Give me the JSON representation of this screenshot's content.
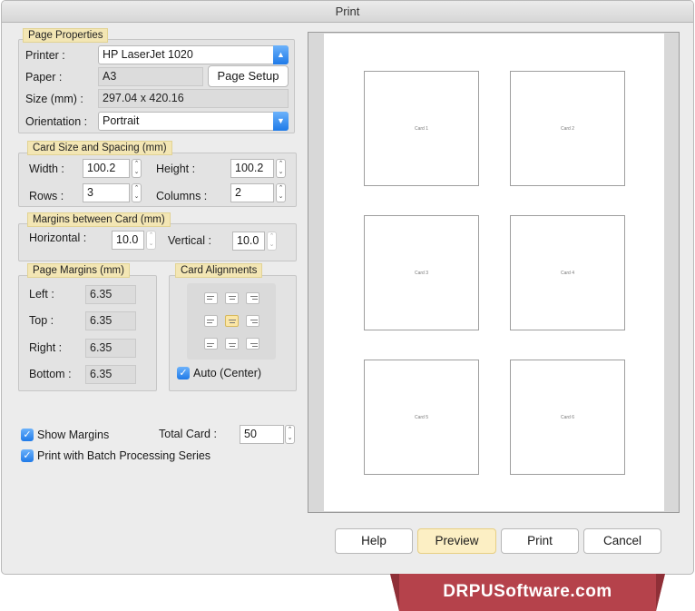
{
  "window": {
    "title": "Print"
  },
  "page_properties": {
    "legend": "Page Properties",
    "printer_label": "Printer :",
    "printer_value": "HP LaserJet 1020",
    "paper_label": "Paper :",
    "paper_value": "A3",
    "page_setup_label": "Page Setup",
    "size_label": "Size (mm) :",
    "size_value": "297.04 x 420.16",
    "orientation_label": "Orientation :",
    "orientation_value": "Portrait"
  },
  "card_size": {
    "legend": "Card Size and Spacing (mm)",
    "width_label": "Width :",
    "width_value": "100.2",
    "height_label": "Height :",
    "height_value": "100.2",
    "rows_label": "Rows :",
    "rows_value": "3",
    "columns_label": "Columns :",
    "columns_value": "2"
  },
  "margins_between": {
    "legend": "Margins between Card (mm)",
    "horizontal_label": "Horizontal :",
    "horizontal_value": "10.0",
    "vertical_label": "Vertical :",
    "vertical_value": "10.0"
  },
  "page_margins": {
    "legend": "Page Margins (mm)",
    "left_label": "Left :",
    "left_value": "6.35",
    "top_label": "Top :",
    "top_value": "6.35",
    "right_label": "Right :",
    "right_value": "6.35",
    "bottom_label": "Bottom :",
    "bottom_value": "6.35"
  },
  "card_alignments": {
    "legend": "Card Alignments",
    "selected": "middle-center",
    "auto_label": "Auto (Center)",
    "auto_checked": true
  },
  "options": {
    "show_margins_label": "Show Margins",
    "show_margins_checked": true,
    "batch_label": "Print with Batch Processing Series",
    "batch_checked": true,
    "total_card_label": "Total Card :",
    "total_card_value": "50"
  },
  "preview": {
    "cards": [
      "Card 1",
      "Card 2",
      "Card 3",
      "Card 4",
      "Card 5",
      "Card 6"
    ]
  },
  "buttons": {
    "help": "Help",
    "preview": "Preview",
    "print": "Print",
    "cancel": "Cancel"
  },
  "watermark": {
    "text": "DRPUSoftware.com"
  },
  "colors": {
    "legend_bg": "#f3e6b4",
    "accent_blue": "#1f7ae8",
    "default_button": "#fcefc4",
    "watermark_red": "#b5424b"
  },
  "icons": {
    "check": "checkmark-icon",
    "dropdown": "chevron-updown-icon",
    "stepper": "stepper-arrows-icon"
  }
}
